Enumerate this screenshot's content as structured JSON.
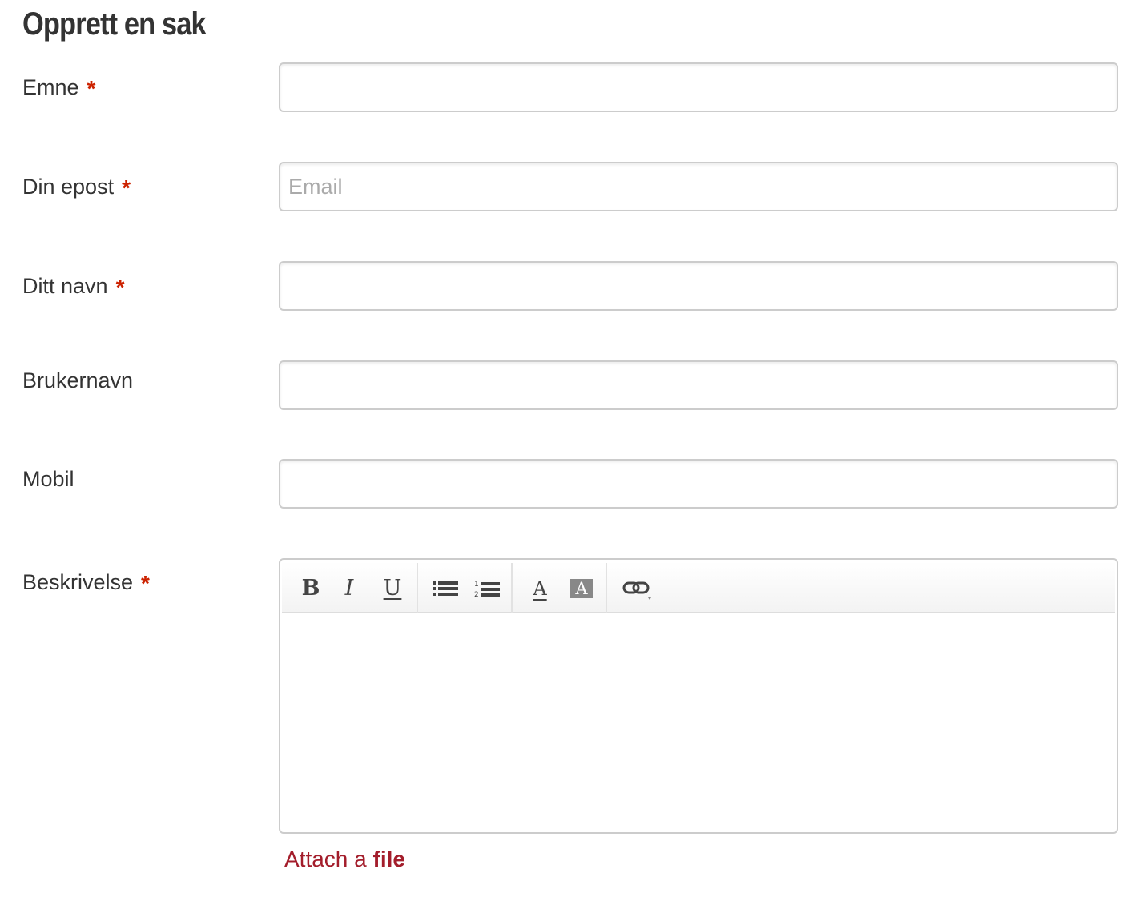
{
  "page": {
    "title": "Opprett en sak"
  },
  "form": {
    "required_mark": "*",
    "fields": {
      "emne": {
        "label": "Emne",
        "value": "",
        "placeholder": ""
      },
      "epost": {
        "label": "Din epost",
        "value": "",
        "placeholder": "Email"
      },
      "navn": {
        "label": "Ditt navn",
        "value": "",
        "placeholder": ""
      },
      "brukernavn": {
        "label": "Brukernavn",
        "value": "",
        "placeholder": ""
      },
      "mobil": {
        "label": "Mobil",
        "value": "",
        "placeholder": ""
      },
      "beskrivelse": {
        "label": "Beskrivelse",
        "value": ""
      }
    }
  },
  "toolbar": {
    "bold": "B",
    "italic": "I",
    "underline": "U",
    "text_color": "A",
    "highlight": "A",
    "icons": [
      "bold-icon",
      "italic-icon",
      "underline-icon",
      "bullet-list-icon",
      "numbered-list-icon",
      "text-color-icon",
      "highlight-color-icon",
      "link-icon"
    ]
  },
  "attach": {
    "prefix": "Attach a",
    "emphasis": "file"
  },
  "colors": {
    "required": "#cc2200",
    "link": "#a31d2b",
    "text": "#333333",
    "border": "#cccccc"
  }
}
